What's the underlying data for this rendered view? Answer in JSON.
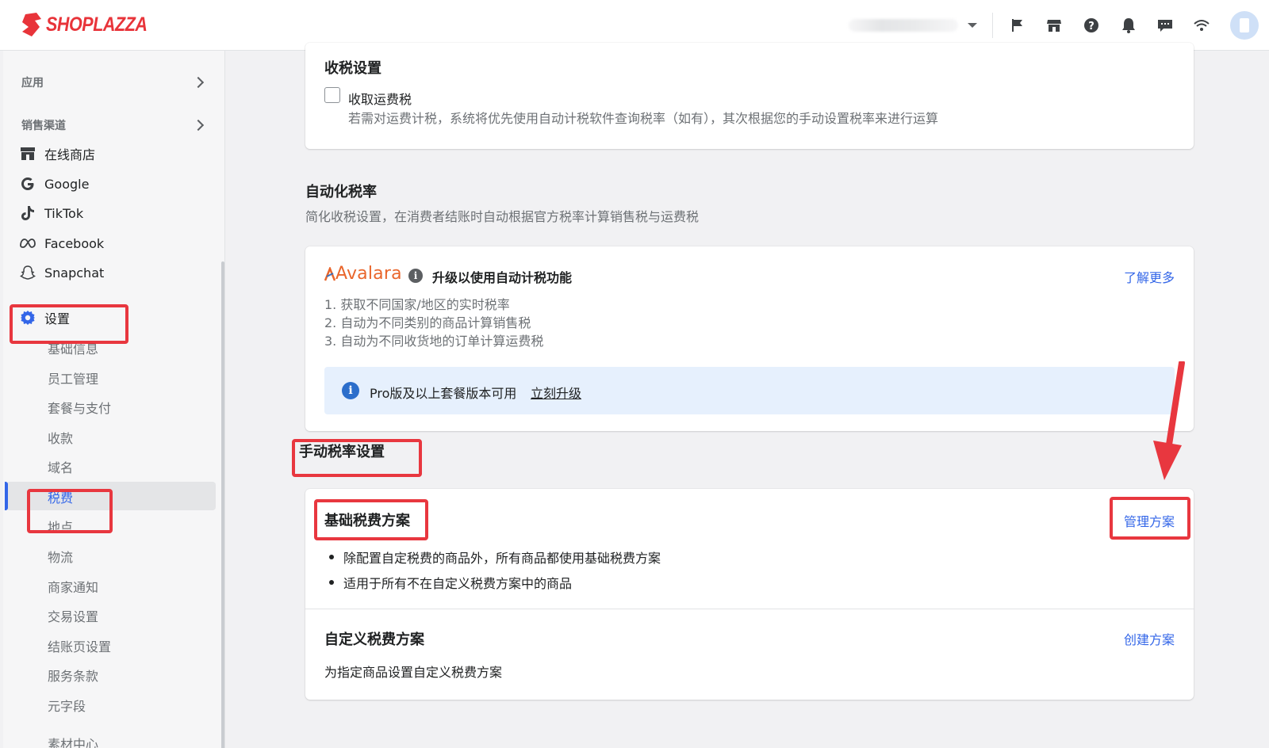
{
  "brand": {
    "name": "SHOPLAZZA",
    "color": "#e8343a"
  },
  "header": {
    "icons": [
      "flag-icon",
      "store-icon",
      "help-icon",
      "bell-icon",
      "chat-icon",
      "wifi-icon"
    ]
  },
  "sidebar": {
    "apps_label": "应用",
    "channels_label": "销售渠道",
    "channels": [
      {
        "label": "在线商店",
        "icon": "storefront-icon"
      },
      {
        "label": "Google",
        "icon": "google-icon"
      },
      {
        "label": "TikTok",
        "icon": "tiktok-icon"
      },
      {
        "label": "Facebook",
        "icon": "meta-icon"
      },
      {
        "label": "Snapchat",
        "icon": "snapchat-icon"
      }
    ],
    "settings_label": "设置",
    "settings_items": [
      "基础信息",
      "员工管理",
      "套餐与支付",
      "收款",
      "域名",
      "税费",
      "地点",
      "物流",
      "商家通知",
      "交易设置",
      "结账页设置",
      "服务条款",
      "元字段",
      "素材中心"
    ],
    "active_item": "税费"
  },
  "tax_collection": {
    "title": "收税设置",
    "checkbox_label": "收取运费税",
    "checkbox_checked": false,
    "help": "若需对运费计税，系统将优先使用自动计税软件查询税率（如有），其次根据您的手动设置税率来进行运算"
  },
  "auto_tax": {
    "title": "自动化税率",
    "description": "简化收税设置，在消费者结账时自动根据官方税率计算销售税与运费税",
    "provider": "Avalara",
    "upgrade_title": "升级以使用自动计税功能",
    "learn_more": "了解更多",
    "features": [
      "1. 获取不同国家/地区的实时税率",
      "2. 自动为不同类别的商品计算销售税",
      "3. 自动为不同收货地的订单计算运费税"
    ],
    "banner_text": "Pro版及以上套餐版本可用",
    "banner_link": "立刻升级"
  },
  "manual_tax": {
    "title": "手动税率设置",
    "basic": {
      "title": "基础税费方案",
      "action": "管理方案",
      "bullets": [
        "除配置自定税费的商品外，所有商品都使用基础税费方案",
        "适用于所有不在自定义税费方案中的商品"
      ]
    },
    "custom": {
      "title": "自定义税费方案",
      "action": "创建方案",
      "description": "为指定商品设置自定义税费方案"
    }
  },
  "colors": {
    "link": "#3366e8",
    "annotation": "#e8373f",
    "banner_bg": "#e6f0fd"
  }
}
